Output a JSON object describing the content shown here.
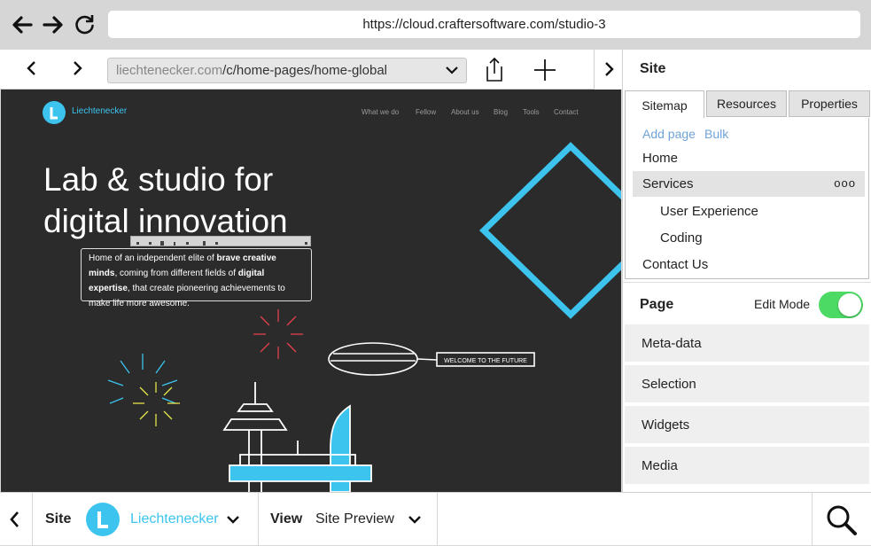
{
  "browser": {
    "url": "https://cloud.craftersoftware.com/studio-3"
  },
  "toolbar": {
    "path_host": "liechtenecker.com",
    "path_rest": "/c/home-pages/home-global"
  },
  "preview": {
    "brand": "Liechtenecker",
    "nav": [
      "What we do",
      "Fellow",
      "About us",
      "Blog",
      "Tools",
      "Contact"
    ],
    "headline_line1": "Lab & studio for",
    "headline_line2": "digital innovation",
    "intro_1": "Home of an independent elite of ",
    "intro_bold1": "brave creative minds",
    "intro_2": ", coming from different fields of ",
    "intro_bold2": "digital expertise",
    "intro_3": ", that create pioneering achievements to make life more awesome.",
    "banner": "WELCOME TO THE FUTURE"
  },
  "sidebar": {
    "title": "Site",
    "tabs": [
      "Sitemap",
      "Resources",
      "Properties"
    ],
    "actions": {
      "add_page": "Add page",
      "bulk": "Bulk"
    },
    "tree": [
      {
        "label": "Home",
        "level": 0
      },
      {
        "label": "Services",
        "level": 0,
        "selected": true,
        "menu": "ooo"
      },
      {
        "label": "User Experience",
        "level": 1
      },
      {
        "label": "Coding",
        "level": 1
      },
      {
        "label": "Contact Us",
        "level": 0
      }
    ],
    "page_title": "Page",
    "edit_mode_label": "Edit Mode",
    "edit_mode_on": true,
    "sections": [
      "Meta-data",
      "Selection",
      "Widgets",
      "Media"
    ]
  },
  "bottom": {
    "site_label": "Site",
    "site_name": "Liechtenecker",
    "view_label": "View",
    "view_value": "Site Preview"
  },
  "colors": {
    "accent": "#3cc4ef",
    "toggle_on": "#4cd964",
    "preview_bg": "#2b2b2b"
  }
}
